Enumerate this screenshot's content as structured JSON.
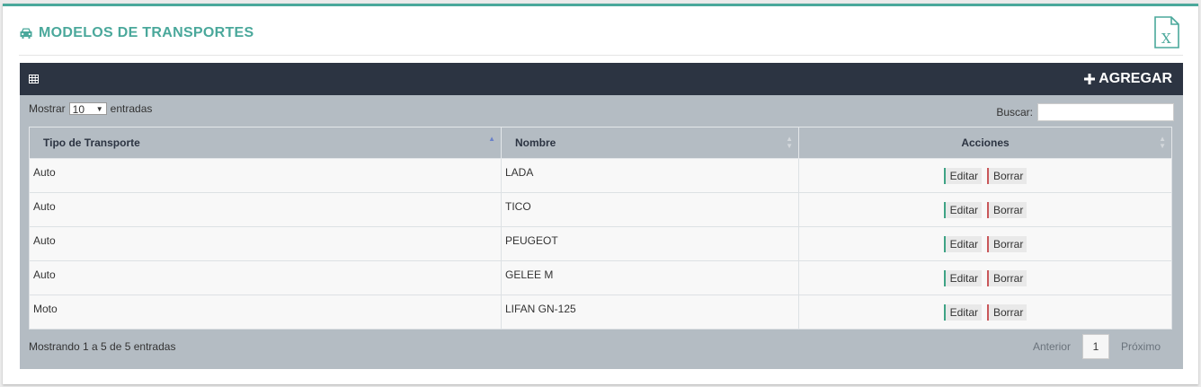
{
  "header": {
    "title": "MODELOS DE TRANSPORTES",
    "title_icon": "car-icon",
    "export_icon": "excel-icon",
    "accent_color": "#4aa89b"
  },
  "box": {
    "header_icon": "table-icon",
    "add_label": "AGREGAR",
    "add_icon": "plus-icon",
    "header_color": "#2c3442"
  },
  "controls": {
    "show_label": "Mostrar",
    "page_size": "10",
    "entries_label": "entradas",
    "search_label": "Buscar:",
    "search_value": ""
  },
  "table": {
    "columns": [
      "Tipo de Transporte",
      "Nombre",
      "Acciones"
    ],
    "rows": [
      {
        "tipo": "Auto",
        "nombre": "LADA"
      },
      {
        "tipo": "Auto",
        "nombre": "TICO"
      },
      {
        "tipo": "Auto",
        "nombre": "PEUGEOT"
      },
      {
        "tipo": "Auto",
        "nombre": "GELEE M"
      },
      {
        "tipo": "Moto",
        "nombre": "LIFAN GN-125"
      }
    ],
    "edit_label": "Editar",
    "delete_label": "Borrar"
  },
  "footer": {
    "info": "Mostrando 1 a 5 de 5 entradas",
    "prev_label": "Anterior",
    "current_page": "1",
    "next_label": "Próximo"
  }
}
